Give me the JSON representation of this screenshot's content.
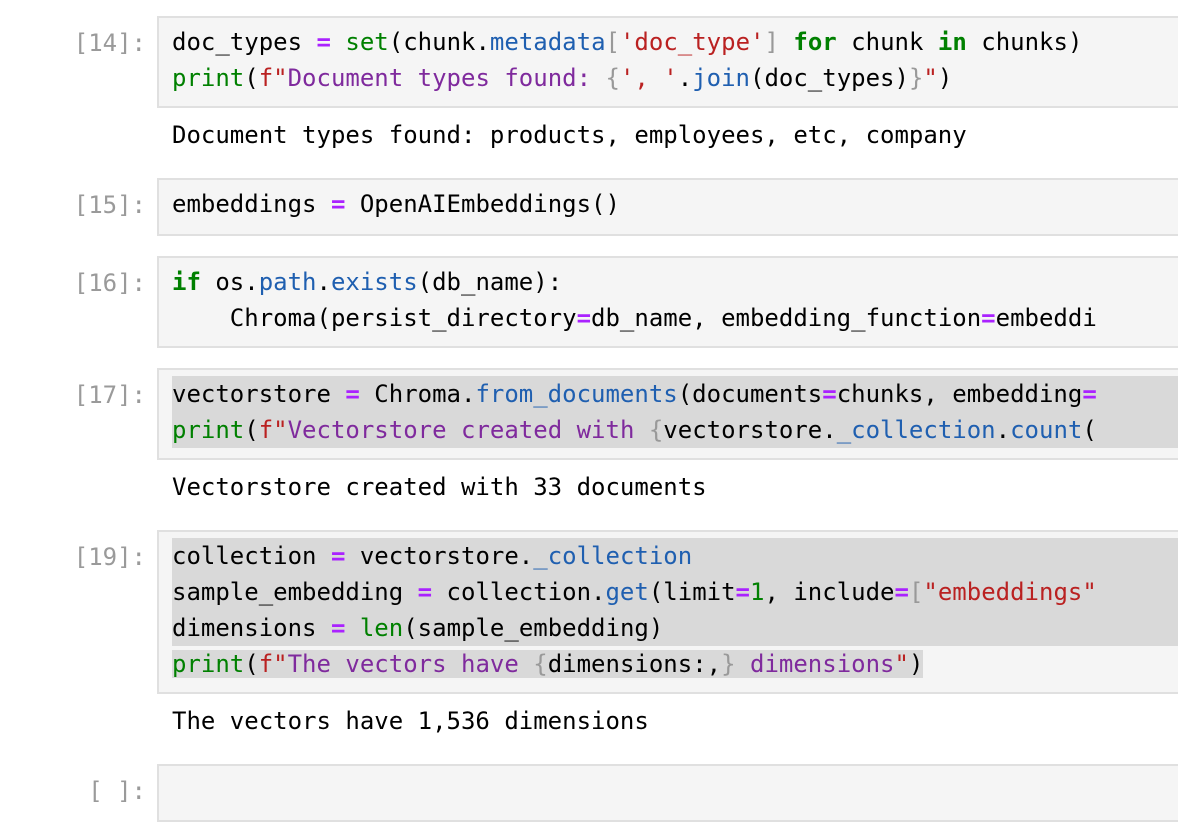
{
  "cells": [
    {
      "prompt": "[14]:",
      "code_lines": [
        "doc_types = set(chunk.metadata['doc_type'] for chunk in chunks)",
        "print(f\"Document types found: {', '.join(doc_types)}\")"
      ],
      "output": "Document types found: products, employees, etc, company"
    },
    {
      "prompt": "[15]:",
      "code_lines": [
        "embeddings = OpenAIEmbeddings()"
      ],
      "output": ""
    },
    {
      "prompt": "[16]:",
      "code_lines": [
        "if os.path.exists(db_name):",
        "    Chroma(persist_directory=db_name, embedding_function=embeddi"
      ],
      "output": ""
    },
    {
      "prompt": "[17]:",
      "code_lines": [
        "vectorstore = Chroma.from_documents(documents=chunks, embedding=",
        "print(f\"Vectorstore created with {vectorstore._collection.count("
      ],
      "output": "Vectorstore created with 33 documents"
    },
    {
      "prompt": "[19]:",
      "code_lines": [
        "collection = vectorstore._collection",
        "sample_embedding = collection.get(limit=1, include=[\"embeddings\"",
        "dimensions = len(sample_embedding)",
        "print(f\"The vectors have {dimensions:,} dimensions\")"
      ],
      "output": "The vectors have 1,536 dimensions"
    },
    {
      "prompt": "[ ]:",
      "code_lines": [],
      "output": ""
    }
  ],
  "colors": {
    "keyword": "#008000",
    "operator": "#aa22ff",
    "string": "#ba2121",
    "attribute": "#1f5fb0",
    "prompt": "#9a9a9a",
    "cell_background": "#f5f5f5",
    "selection": "#d9d9d9"
  }
}
